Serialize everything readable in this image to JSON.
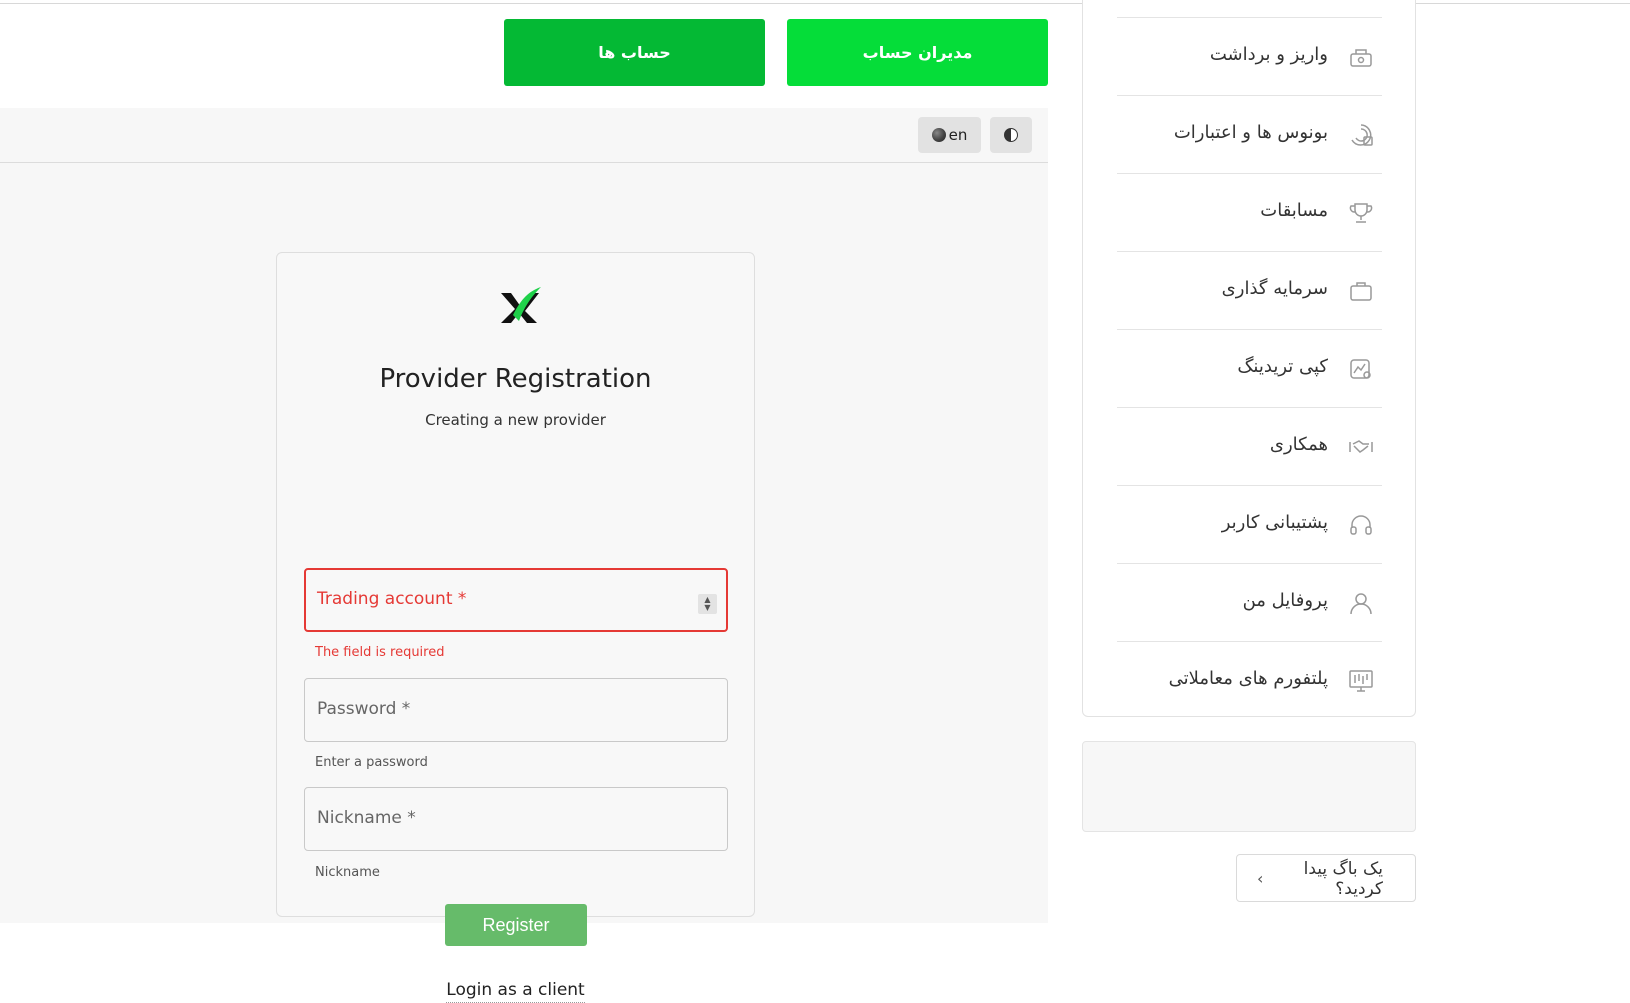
{
  "top_buttons": {
    "accounts_label": "حساب ها",
    "managers_label": "مدیران حساب"
  },
  "toolbar": {
    "language": "en",
    "theme_icon": "contrast-icon"
  },
  "card": {
    "title": "Provider Registration",
    "subtitle": "Creating a new provider",
    "fields": [
      {
        "placeholder": "Trading account *",
        "helper": "The field is required",
        "state": "error"
      },
      {
        "placeholder": "Password *",
        "helper": "Enter a password",
        "state": "normal"
      },
      {
        "placeholder": "Nickname *",
        "helper": "Nickname",
        "state": "normal"
      }
    ],
    "register_label": "Register",
    "login_link": "Login as a client"
  },
  "sidebar": {
    "items": [
      {
        "label": "واریز و برداشت",
        "icon": "deposit-icon"
      },
      {
        "label": "بونوس ها و اعتبارات",
        "icon": "bonus-icon"
      },
      {
        "label": "مسابقات",
        "icon": "trophy-icon"
      },
      {
        "label": "سرمایه گذاری",
        "icon": "briefcase-icon"
      },
      {
        "label": "کپی تریدینگ",
        "icon": "copy-trading-icon"
      },
      {
        "label": "همکاری",
        "icon": "handshake-icon"
      },
      {
        "label": "پشتیبانی کاربر",
        "icon": "headset-icon"
      },
      {
        "label": "پروفایل من",
        "icon": "user-icon"
      },
      {
        "label": "پلتفورم های معاملاتی",
        "icon": "platform-icon"
      }
    ]
  },
  "bug_report": {
    "label": "یک باگ پیدا کردید؟"
  },
  "colors": {
    "accounts_green": "#04b934",
    "managers_green": "#05dd39",
    "register_green": "#66bb6a",
    "error_red": "#e53935"
  }
}
